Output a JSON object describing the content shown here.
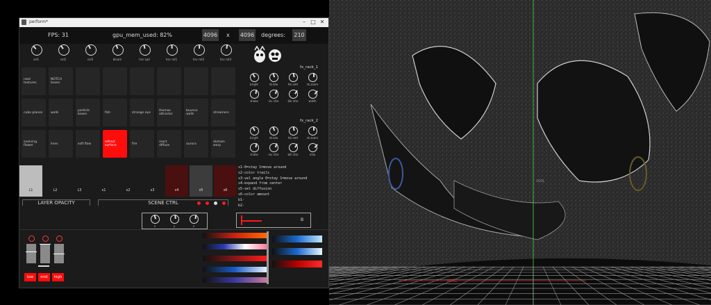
{
  "window": {
    "title": "perform*"
  },
  "topbar": {
    "fps": "FPS: 31",
    "gpu": "gpu_mem_used: 82%",
    "width": "4096",
    "x": "x",
    "height": "4096",
    "deg_label": "degrees:",
    "deg_value": "210"
  },
  "knobs": [
    "col1",
    "col2",
    "col3",
    "bloom",
    "hsv spd",
    "hsv rot1",
    "hsv rot2",
    "hsv rot3"
  ],
  "pads": [
    [
      "next\ntextures",
      "NOTCH boxes",
      "",
      "",
      "",
      "",
      "",
      ""
    ],
    [
      "cube planes",
      "walls",
      "particle\nboxes",
      "fish",
      "strange eye",
      "thomas\nattractor",
      "bounce walls",
      "streamers"
    ],
    [
      "evolving\nflower",
      "lines",
      "soft flow",
      "refract\nsurface",
      "fire",
      "react\ndiffuse",
      "aurora",
      "domain warp"
    ]
  ],
  "layers": [
    "L1",
    "L2",
    "L3",
    "s1",
    "s2",
    "s3",
    "s4",
    "s5",
    "s6"
  ],
  "sections": {
    "layer_opacity": "LAYER OPACITY",
    "scene_ctrl": "SCENE CTRL"
  },
  "fx1": {
    "title": "fx_rack_1",
    "labels": [
      "bright",
      "rb b/w",
      "hb amt",
      "rb zoom",
      "shake",
      "inv stro",
      "blk stro",
      "width"
    ]
  },
  "fx2": {
    "title": "fx_rack_2",
    "labels": [
      "bright",
      "rb b/w",
      "hb amt",
      "rb zoom",
      "shake",
      "inv stro",
      "blk stro",
      "m/w"
    ]
  },
  "notes": [
    "s1-0=stay 1=move around",
    "s2-color trails",
    "s3-vel angle 0=stay 1=move around",
    "s4-expand from center",
    "s5-vel diffusion",
    "s6-color amount",
    "b1-",
    "b2-"
  ],
  "xyz": [
    "x",
    "y",
    "z"
  ],
  "b_label": "B",
  "bands": [
    "low",
    "mid",
    "high"
  ],
  "viewport": {
    "mid_label": "100L",
    "bottom_label": "m00L"
  },
  "colors": {
    "accent": "#ff0c0c",
    "panel": "#1b1b1b",
    "pad": "#262626"
  }
}
